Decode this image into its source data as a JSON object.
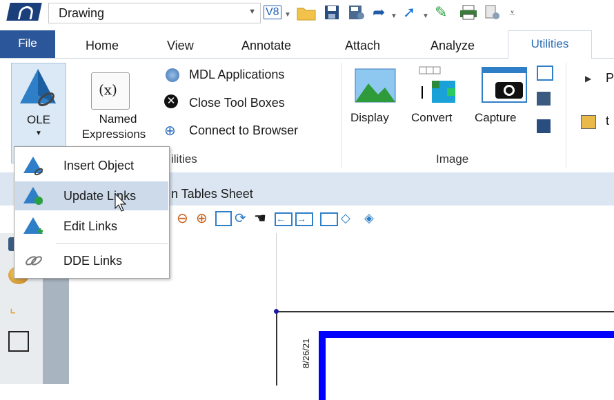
{
  "quick_access": {
    "workspace_combo": "Drawing",
    "icons": [
      "v8-icon",
      "open-folder-icon",
      "save-icon",
      "save-settings-icon",
      "undo-icon",
      "redo-icon",
      "pin-icon",
      "print-icon",
      "properties-icon",
      "customize-icon"
    ],
    "v8_label": "V8"
  },
  "tabs": [
    "File",
    "Home",
    "View",
    "Annotate",
    "Attach",
    "Analyze",
    "Utilities"
  ],
  "active_tab": "Utilities",
  "ribbon": {
    "ole_label": "OLE",
    "named_expr_label_1": "Named",
    "named_expr_label_2": "Expressions",
    "mdl_label": "MDL Applications",
    "close_tool_boxes_label": "Close Tool Boxes",
    "connect_browser_label": "Connect to Browser",
    "utilities_group_partial": "ilities",
    "display_label": "Display",
    "convert_label": "Convert",
    "capture_label": "Capture",
    "image_group_label": "Image",
    "right_partial_1": "P",
    "right_partial_2": "t"
  },
  "menu": {
    "items": [
      {
        "label": "Insert Object",
        "icon": "ole-insert-icon"
      },
      {
        "label": "Update Links",
        "icon": "ole-update-icon"
      },
      {
        "label": "Edit Links",
        "icon": "ole-edit-icon"
      },
      {
        "label": "DDE Links",
        "icon": "dde-link-icon"
      }
    ],
    "highlighted_index": 1
  },
  "sheet": {
    "title_partial": "n Tables Sheet",
    "date_text": "8/26/21"
  },
  "colors": {
    "file_tab_bg": "#2b579a",
    "active_tab_text": "#2b6cb3",
    "menu_highlight": "#ccdaea",
    "drawing_frame": "#0000ff"
  }
}
